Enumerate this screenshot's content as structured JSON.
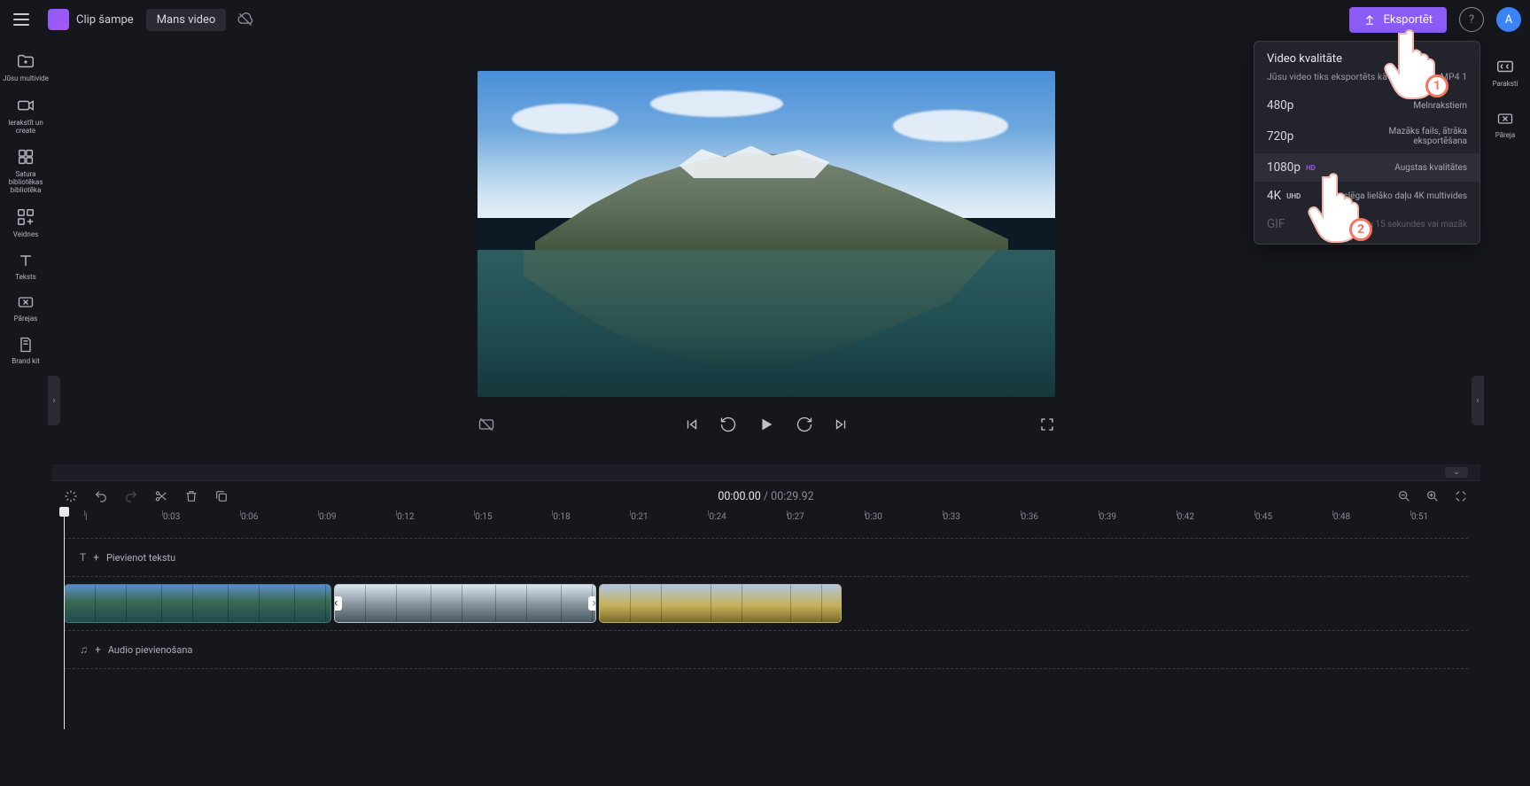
{
  "header": {
    "app_name": "Clip šampe",
    "project_title": "Mans video",
    "export_label": "Eksportēt",
    "avatar_initial": "A"
  },
  "left_sidebar": {
    "items": [
      {
        "label": "Jūsu multivide"
      },
      {
        "label": "Ierakstīt un create"
      },
      {
        "label": "Satura bibliotēkas bibliotēka"
      },
      {
        "label": "Veidnes"
      },
      {
        "label": "Teksts"
      },
      {
        "label": "Pārejas"
      },
      {
        "label": "Brand kit"
      }
    ]
  },
  "right_sidebar": {
    "items": [
      {
        "label": "Paraksti"
      },
      {
        "label": "Pāreja"
      }
    ]
  },
  "player": {
    "current_time": "00:00.00",
    "total_time": "00:29.92"
  },
  "export_panel": {
    "title": "Video kvalitāte",
    "subtitle_prefix": "Jūsu video tiks eksportēts kā",
    "subtitle_format": "MP4 1",
    "options": [
      {
        "quality": "480p",
        "badge": "",
        "desc": "Melnrakstiem",
        "selected": false,
        "disabled": false
      },
      {
        "quality": "720p",
        "badge": "",
        "desc": "Mazāks fails, ātrāka eksportēšana",
        "selected": false,
        "disabled": false
      },
      {
        "quality": "1080p",
        "badge": "HD",
        "desc": "Augstas kvalitātes",
        "selected": true,
        "disabled": false
      },
      {
        "quality": "4K",
        "badge": "UHD",
        "desc": "atslēga lielāko daļu 4K multivides",
        "selected": false,
        "disabled": false
      },
      {
        "quality": "GIF",
        "badge": "",
        "desc": "failu 15 sekundes vai mazāk",
        "selected": false,
        "disabled": true
      }
    ]
  },
  "pointers": {
    "p1": "1",
    "p2": "2"
  },
  "timeline": {
    "add_text_label": "Pievienot tekstu",
    "add_audio_label": "Audio pievienošana",
    "ruler_marks": [
      "|",
      "0:03",
      "0:06",
      "0:09",
      "0:12",
      "0:15",
      "0:18",
      "0:21",
      "0:24",
      "0:27",
      "0:30",
      "0:33",
      "0:36",
      "0:39",
      "0:42",
      "0:45",
      "0:48",
      "0:51"
    ]
  }
}
